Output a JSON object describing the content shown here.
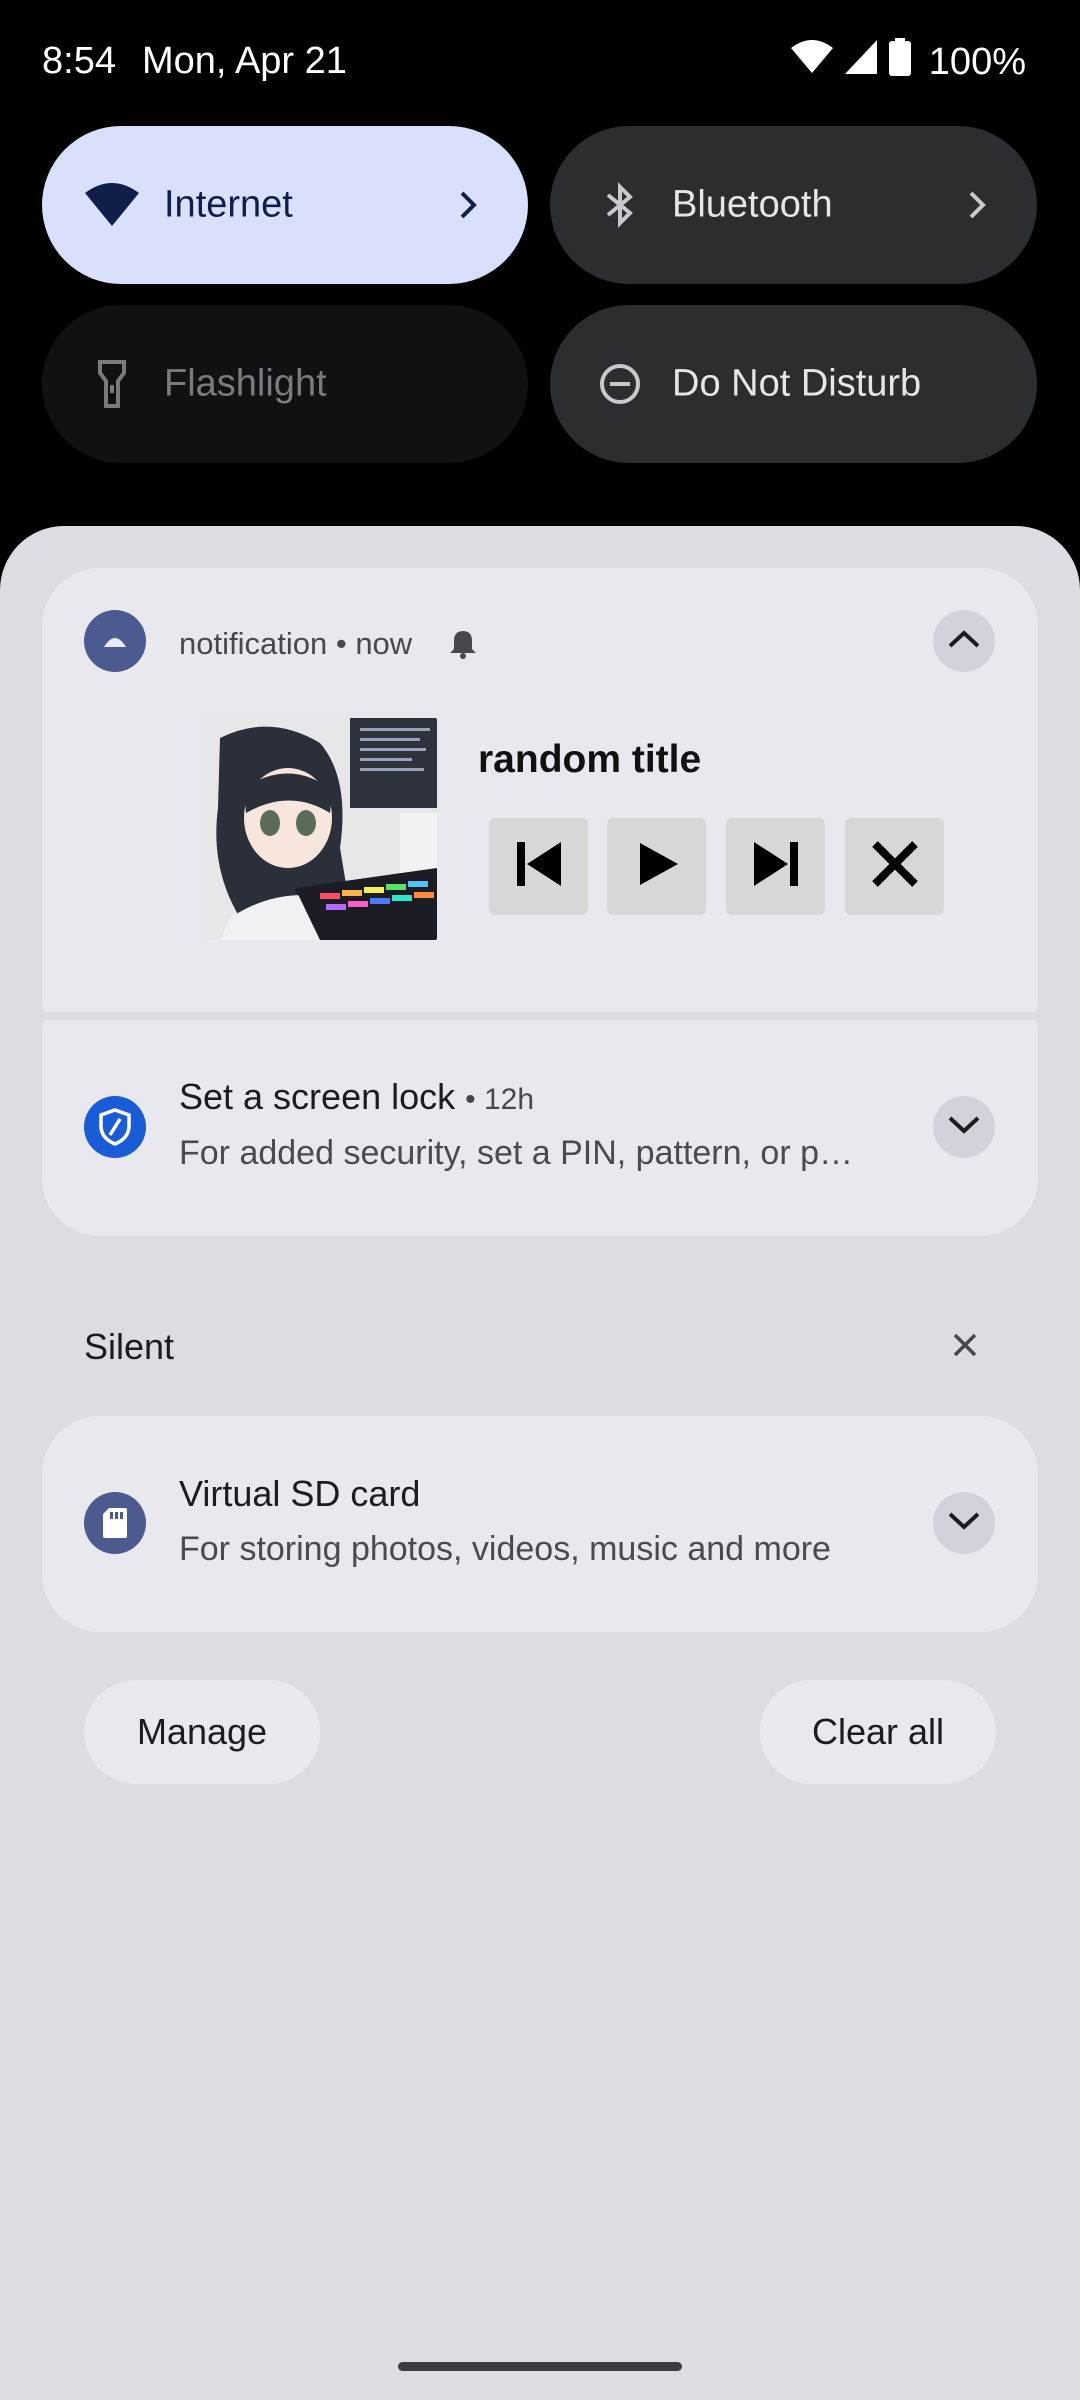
{
  "status_bar": {
    "time": "8:54",
    "date": "Mon, Apr 21",
    "battery": "100%",
    "icons": [
      "wifi-icon",
      "signal-icon",
      "battery-icon"
    ]
  },
  "quick_settings": [
    {
      "label": "Internet",
      "icon": "wifi-icon",
      "active": true
    },
    {
      "label": "Bluetooth",
      "icon": "bluetooth-icon",
      "active": false
    },
    {
      "label": "Flashlight",
      "icon": "flashlight-icon",
      "active": false,
      "unavailable": true
    },
    {
      "label": "Do Not Disturb",
      "icon": "dnd-icon",
      "active": false
    }
  ],
  "media_notification": {
    "app_name": "notification",
    "time": "now",
    "title": "random title",
    "art_icon": "anime-girl-keyboard-art",
    "controls": [
      "previous-icon",
      "play-icon",
      "next-icon",
      "close-icon"
    ]
  },
  "screen_lock_notification": {
    "title": "Set a screen lock",
    "time": "12h",
    "body": "For added security, set a PIN, pattern, or p…",
    "icon": "shield-icon"
  },
  "silent_section": {
    "label": "Silent"
  },
  "sd_card_notification": {
    "title": "Virtual SD card",
    "body": "For storing photos, videos, music and more",
    "icon": "sd-card-icon"
  },
  "buttons": {
    "manage": "Manage",
    "clear_all": "Clear all"
  },
  "colors": {
    "accent": "#d8e0fb",
    "shade_bg": "#dcdce2",
    "card_bg": "#e9e8ef",
    "security_blue": "#1a5cd6"
  }
}
